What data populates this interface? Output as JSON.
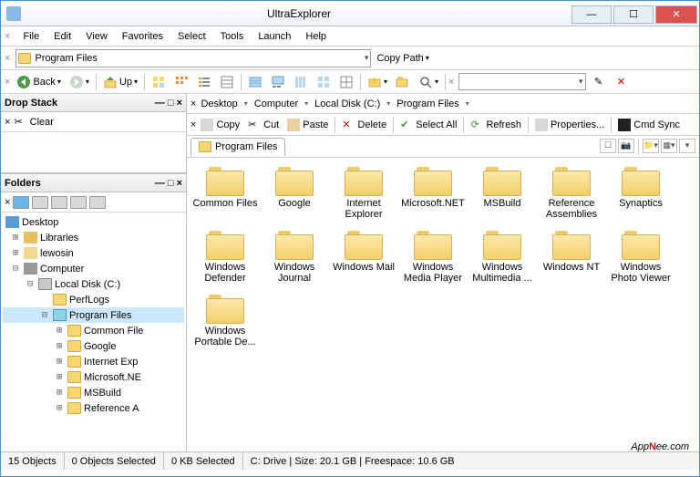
{
  "window": {
    "title": "UltraExplorer"
  },
  "menu": {
    "items": [
      "File",
      "Edit",
      "View",
      "Favorites",
      "Select",
      "Tools",
      "Launch",
      "Help"
    ]
  },
  "address": {
    "path": "Program Files",
    "copy_path": "Copy Path"
  },
  "nav": {
    "back": "Back",
    "up": "Up"
  },
  "breadcrumb": {
    "items": [
      "Desktop",
      "Computer",
      "Local Disk (C:)",
      "Program Files"
    ]
  },
  "actions": {
    "copy": "Copy",
    "cut": "Cut",
    "paste": "Paste",
    "delete": "Delete",
    "select_all": "Select All",
    "refresh": "Refresh",
    "properties": "Properties...",
    "cmd_sync": "Cmd Sync"
  },
  "tab": {
    "label": "Program Files"
  },
  "dropstack": {
    "title": "Drop Stack",
    "clear": "Clear"
  },
  "folders_panel": {
    "title": "Folders"
  },
  "tree": {
    "desktop": "Desktop",
    "libraries": "Libraries",
    "user": "lewosin",
    "computer": "Computer",
    "drive": "Local Disk (C:)",
    "perflogs": "PerfLogs",
    "program_files": "Program Files",
    "children": [
      "Common File",
      "Google",
      "Internet Exp",
      "Microsoft.NE",
      "MSBuild",
      "Reference A"
    ]
  },
  "files": [
    "Common Files",
    "Google",
    "Internet Explorer",
    "Microsoft.NET",
    "MSBuild",
    "Reference Assemblies",
    "Synaptics",
    "Windows Defender",
    "Windows Journal",
    "Windows Mail",
    "Windows Media Player",
    "Windows Multimedia ...",
    "Windows NT",
    "Windows Photo Viewer",
    "Windows Portable De..."
  ],
  "status": {
    "objects": "15 Objects",
    "selected": "0 Objects Selected",
    "kb": "0 KB Selected",
    "drive": "C: Drive | Size: 20.1 GB | Freespace: 10.6 GB"
  },
  "watermark": {
    "a": "App",
    "b": "N",
    "c": "ee.com"
  }
}
